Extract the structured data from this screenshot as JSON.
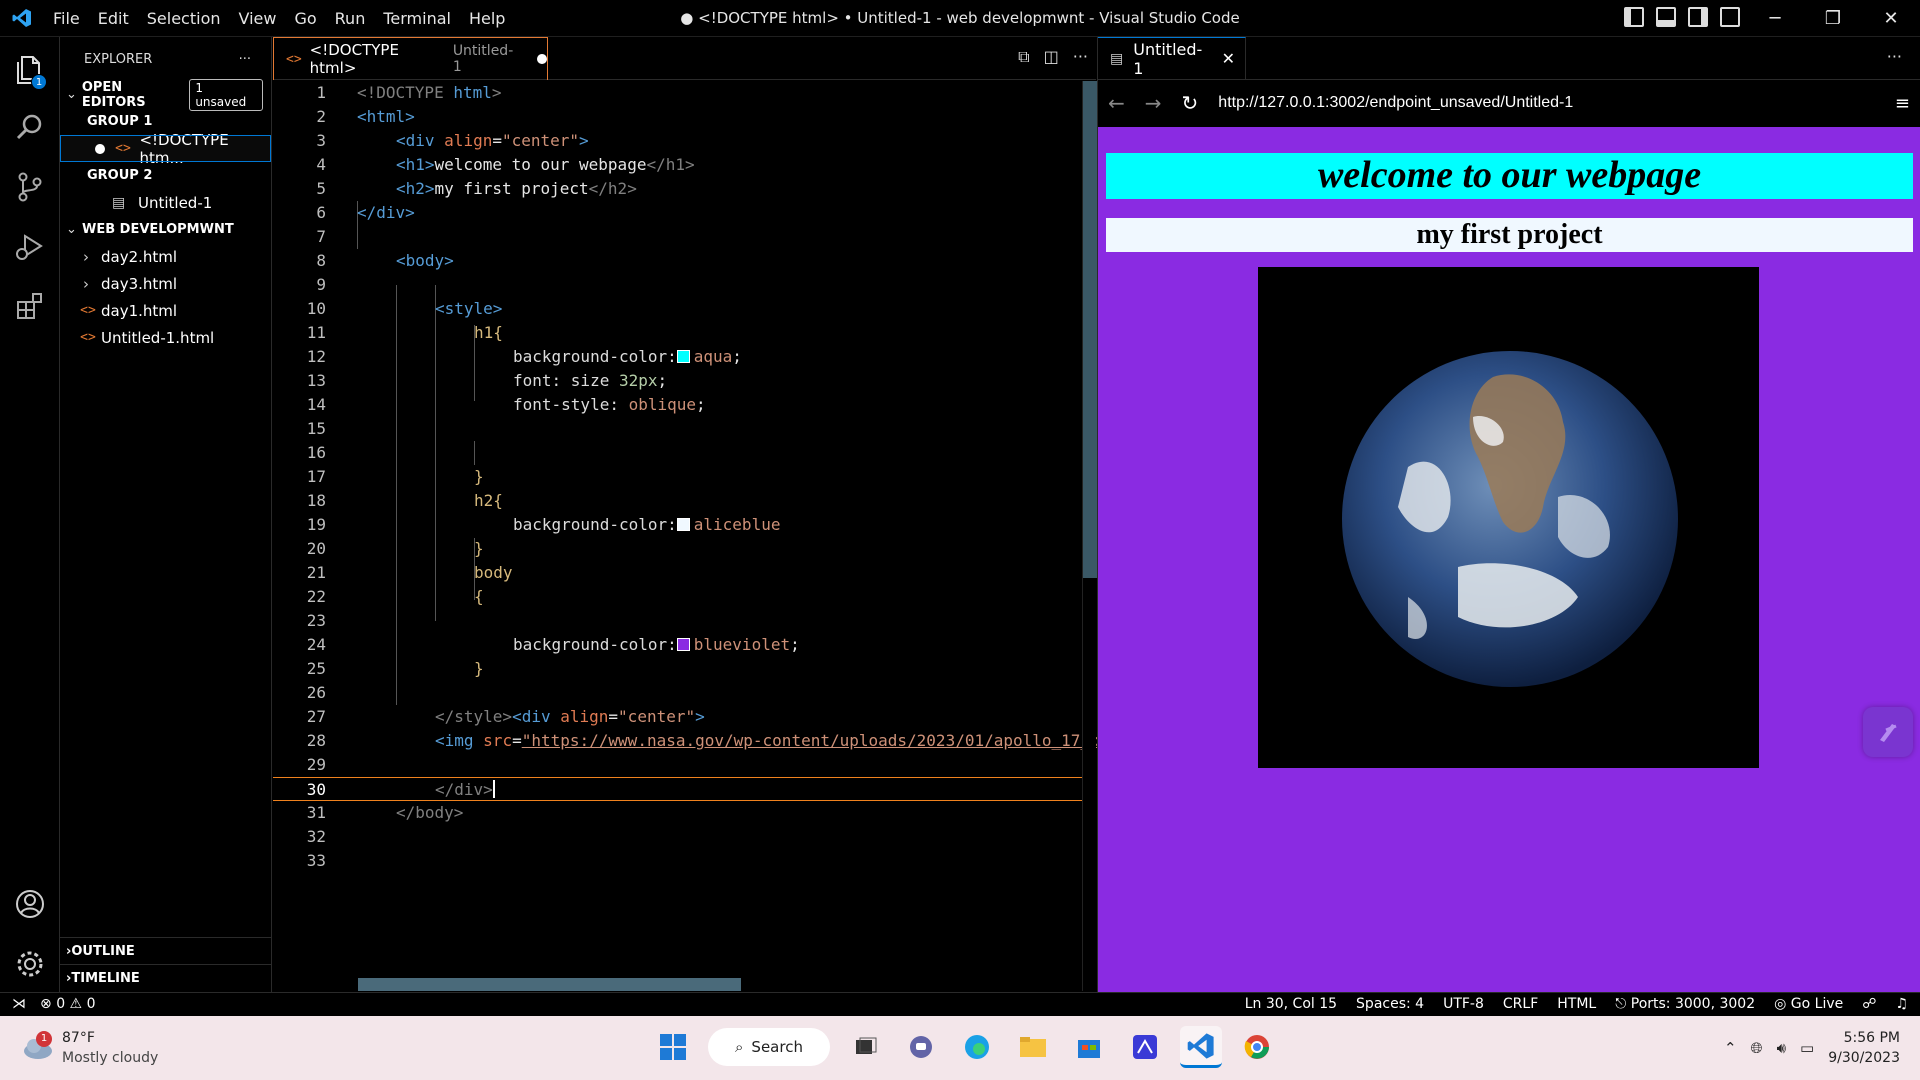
{
  "titlebar": {
    "menu": [
      "File",
      "Edit",
      "Selection",
      "View",
      "Go",
      "Run",
      "Terminal",
      "Help"
    ],
    "window_title": "● <!DOCTYPE html> • Untitled-1 - web developmwnt - Visual Studio Code"
  },
  "activity": {
    "explorer_badge": "1"
  },
  "sidebar": {
    "title": "EXPLORER",
    "more": "···",
    "open_editors": "OPEN EDITORS",
    "unsaved_badge": "1 unsaved",
    "group1": "GROUP 1",
    "group1_file": "<!DOCTYPE htm...",
    "group2": "GROUP 2",
    "group2_file": "Untitled-1",
    "folder": "WEB DEVELOPMWNT",
    "files": [
      "day2.html",
      "day3.html",
      "day1.html",
      "Untitled-1.html"
    ],
    "outline": "OUTLINE",
    "timeline": "TIMELINE"
  },
  "editor": {
    "tab_title": "<!DOCTYPE html>",
    "tab_sub": "Untitled-1",
    "line_numbers": [
      "1",
      "2",
      "3",
      "4",
      "5",
      "6",
      "7",
      "8",
      "9",
      "10",
      "11",
      "12",
      "13",
      "14",
      "15",
      "16",
      "17",
      "18",
      "19",
      "20",
      "21",
      "22",
      "23",
      "24",
      "25",
      "26",
      "27",
      "28",
      "29",
      "30",
      "31",
      "32",
      "33"
    ],
    "current_line": "30",
    "code": {
      "l1a": "<!DOCTYPE ",
      "l1b": "html",
      "l1c": ">",
      "l2": "<html>",
      "l3a": "<div ",
      "l3b": "align",
      "l3c": "=",
      "l3d": "\"center\"",
      "l3e": ">",
      "l4a": "<h1>",
      "l4b": "welcome to our webpage",
      "l4c": "</h1>",
      "l5a": "<h2>",
      "l5b": "my first project",
      "l5c": "</h2>",
      "l6": "</div>",
      "l8": "<body>",
      "l10": "<style>",
      "l11": "h1{",
      "l12a": "background-color:",
      "l12b": "aqua",
      "l12c": ";",
      "l13a": "font: size ",
      "l13b": "32px",
      "l13c": ";",
      "l14a": "font-style: ",
      "l14b": "oblique",
      "l14c": ";",
      "l17": "}",
      "l18": "h2{",
      "l19a": "background-color:",
      "l19b": "aliceblue",
      "l20": "}",
      "l21": "body",
      "l22": "{",
      "l24a": "background-color:",
      "l24b": "blueviolet",
      "l24c": ";",
      "l25": "}",
      "l27a": "</style>",
      "l27b": "<div ",
      "l27c": "align",
      "l27d": "=",
      "l27e": "\"center\"",
      "l27f": ">",
      "l28a": "<img ",
      "l28b": "src",
      "l28c": "=",
      "l28d": "\"https://www.nasa.gov/wp-content/uploads/2023/01/apollo_17_b",
      "l30": "</div>",
      "l31": "</body>"
    },
    "swatch_colors": {
      "aqua": "#00ffff",
      "aliceblue": "#f0f8ff",
      "blueviolet": "#8a2be2"
    }
  },
  "preview": {
    "tab_title": "Untitled-1",
    "url": "http://127.0.0.1:3002/endpoint_unsaved/Untitled-1",
    "h1": "welcome to our webpage",
    "h2": "my first project",
    "page_bg": "#8a2be2"
  },
  "statusbar": {
    "errors": "0",
    "warnings": "0",
    "position": "Ln 30, Col 15",
    "spaces": "Spaces: 4",
    "encoding": "UTF-8",
    "eol": "CRLF",
    "language": "HTML",
    "ports": "Ports: 3000, 3002",
    "golive": "Go Live"
  },
  "taskbar": {
    "weather_badge": "1",
    "temperature": "87°F",
    "condition": "Mostly cloudy",
    "search": "Search",
    "time": "5:56 PM",
    "date": "9/30/2023"
  }
}
